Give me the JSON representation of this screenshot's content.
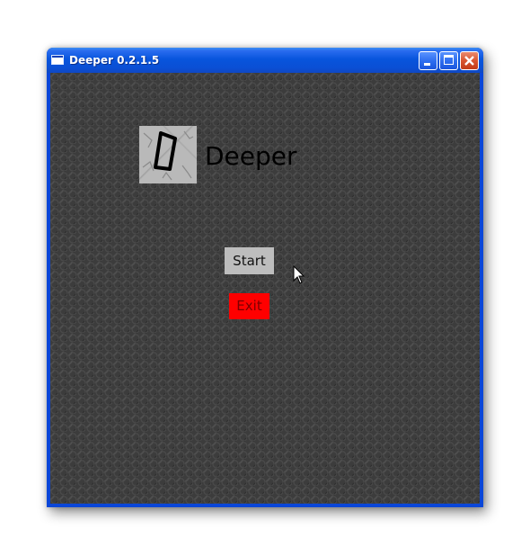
{
  "window": {
    "title": "Deeper 0.2.1.5",
    "controls": [
      "minimize",
      "maximize",
      "close"
    ]
  },
  "game": {
    "logo_icon": "stone-block-d-logo",
    "title": "Deeper",
    "start_label": "Start",
    "exit_label": "Exit"
  },
  "colors": {
    "background": "#3c3c3c",
    "start_button": "#bdbdbd",
    "exit_button": "#ff0000",
    "titlebar": "#0a4fd4"
  },
  "icons": {
    "cursor": "mouse-pointer-icon"
  }
}
